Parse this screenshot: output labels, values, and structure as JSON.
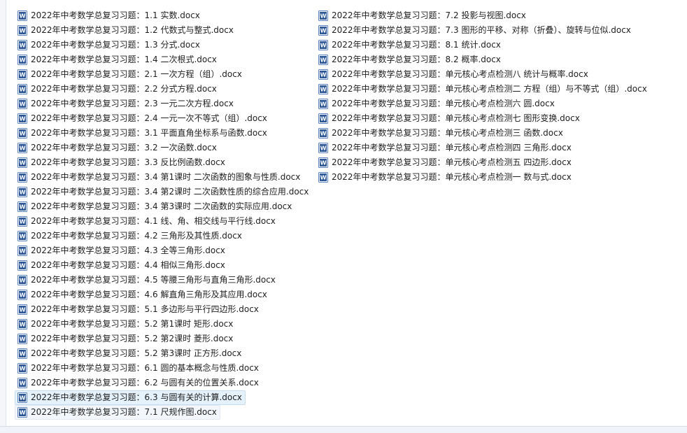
{
  "files": {
    "icon": "word-document-icon",
    "accent": "#2b5797",
    "selection_color": "#e5f1fb",
    "left_column": [
      {
        "name": "2022年中考数学总复习习题：1.1 实数.docx"
      },
      {
        "name": "2022年中考数学总复习习题：1.2 代数式与整式.docx"
      },
      {
        "name": "2022年中考数学总复习习题：1.3 分式.docx"
      },
      {
        "name": "2022年中考数学总复习习题：1.4 二次根式.docx"
      },
      {
        "name": "2022年中考数学总复习习题：2.1 一次方程（组）.docx"
      },
      {
        "name": "2022年中考数学总复习习题：2.2 分式方程.docx"
      },
      {
        "name": "2022年中考数学总复习习题：2.3 一元二次方程.docx"
      },
      {
        "name": "2022年中考数学总复习习题：2.4 一元一次不等式（组）.docx"
      },
      {
        "name": "2022年中考数学总复习习题：3.1 平面直角坐标系与函数.docx"
      },
      {
        "name": "2022年中考数学总复习习题：3.2 一次函数.docx"
      },
      {
        "name": "2022年中考数学总复习习题：3.3 反比例函数.docx"
      },
      {
        "name": "2022年中考数学总复习习题：3.4 第1课时 二次函数的图象与性质.docx"
      },
      {
        "name": "2022年中考数学总复习习题：3.4 第2课时 二次函数性质的综合应用.docx"
      },
      {
        "name": "2022年中考数学总复习习题：3.4 第3课时 二次函数的实际应用.docx"
      },
      {
        "name": "2022年中考数学总复习习题：4.1 线、角、相交线与平行线.docx"
      },
      {
        "name": "2022年中考数学总复习习题：4.2 三角形及其性质.docx"
      },
      {
        "name": "2022年中考数学总复习习题：4.3 全等三角形.docx"
      },
      {
        "name": "2022年中考数学总复习习题：4.4 相似三角形.docx"
      },
      {
        "name": "2022年中考数学总复习习题：4.5 等腰三角形与直角三角形.docx"
      },
      {
        "name": "2022年中考数学总复习习题：4.6 解直角三角形及其应用.docx"
      },
      {
        "name": "2022年中考数学总复习习题：5.1 多边形与平行四边形.docx"
      },
      {
        "name": "2022年中考数学总复习习题：5.2 第1课时 矩形.docx"
      },
      {
        "name": "2022年中考数学总复习习题：5.2 第2课时 菱形.docx"
      },
      {
        "name": "2022年中考数学总复习习题：5.2 第3课时 正方形.docx"
      },
      {
        "name": "2022年中考数学总复习习题：6.1 圆的基本概念与性质.docx"
      },
      {
        "name": "2022年中考数学总复习习题：6.2 与圆有关的位置关系.docx"
      },
      {
        "name": "2022年中考数学总复习习题：6.3 与圆有关的计算.docx",
        "state": "selected"
      },
      {
        "name": "2022年中考数学总复习习题：7.1 尺规作图.docx",
        "state": "hover"
      }
    ],
    "right_column": [
      {
        "name": "2022年中考数学总复习习题：7.2 投影与视图.docx"
      },
      {
        "name": "2022年中考数学总复习习题：7.3 图形的平移、对称（折叠）、旋转与位似.docx"
      },
      {
        "name": "2022年中考数学总复习习题：8.1 统计.docx"
      },
      {
        "name": "2022年中考数学总复习习题：8.2 概率.docx"
      },
      {
        "name": "2022年中考数学总复习习题：单元核心考点检测八 统计与概率.docx"
      },
      {
        "name": "2022年中考数学总复习习题：单元核心考点检测二 方程（组）与不等式（组）.docx"
      },
      {
        "name": "2022年中考数学总复习习题：单元核心考点检测六 圆.docx"
      },
      {
        "name": "2022年中考数学总复习习题：单元核心考点检测七 图形变换.docx"
      },
      {
        "name": "2022年中考数学总复习习题：单元核心考点检测三 函数.docx"
      },
      {
        "name": "2022年中考数学总复习习题：单元核心考点检测四 三角形.docx"
      },
      {
        "name": "2022年中考数学总复习习题：单元核心考点检测五 四边形.docx"
      },
      {
        "name": "2022年中考数学总复习习题：单元核心考点检测一 数与式.docx"
      }
    ]
  }
}
